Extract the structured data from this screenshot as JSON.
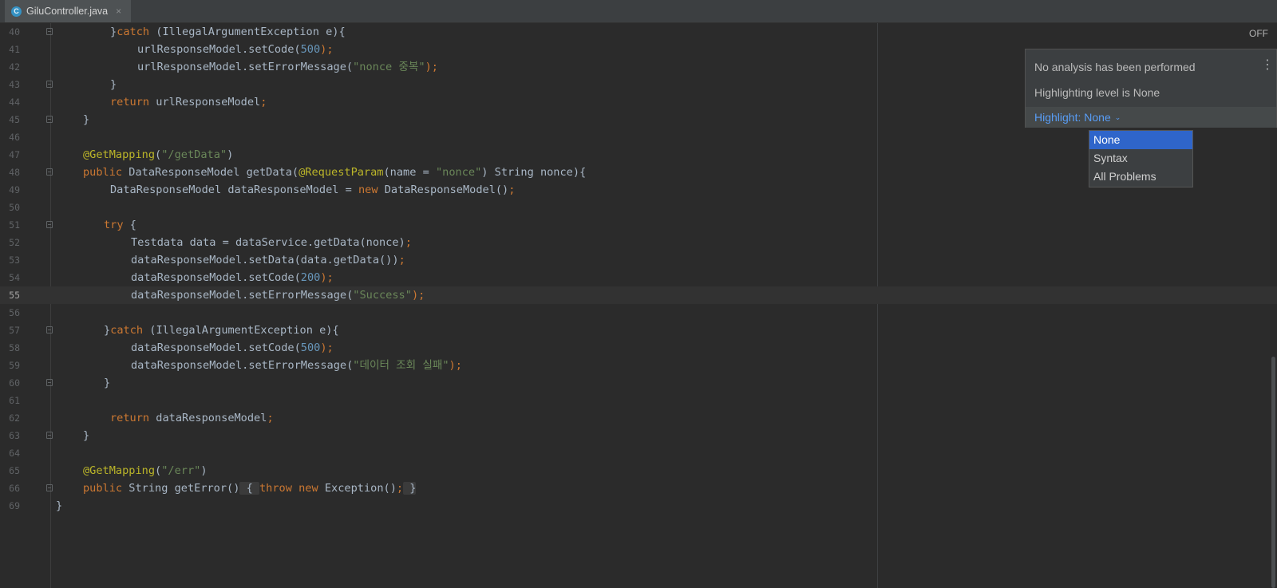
{
  "tab": {
    "icon_letter": "C",
    "filename": "GiluController.java",
    "close": "×"
  },
  "indicator": {
    "status": "OFF"
  },
  "popup": {
    "line1": "No analysis has been performed",
    "line2": "Highlighting level is None",
    "menu_glyph": "⋮",
    "highlight_link": "Highlight: None",
    "chevron": "⌄"
  },
  "dropdown": {
    "options": [
      "None",
      "Syntax",
      "All Problems"
    ],
    "selected": "None"
  },
  "code": {
    "current_line": "55",
    "lines": [
      {
        "num": "40",
        "tokens": [
          "}",
          "catch",
          " (IllegalArgumentException e){"
        ]
      },
      {
        "num": "41",
        "tokens": [
          "urlResponseModel.setCode(",
          "500",
          ");"
        ]
      },
      {
        "num": "42",
        "tokens": [
          "urlResponseModel.setErrorMessage(",
          "\"nonce 중복\"",
          ");"
        ]
      },
      {
        "num": "43",
        "tokens": [
          "}"
        ]
      },
      {
        "num": "44",
        "tokens": [
          "return",
          " urlResponseModel",
          ";"
        ]
      },
      {
        "num": "45",
        "tokens": [
          "}"
        ]
      },
      {
        "num": "46",
        "tokens": []
      },
      {
        "num": "47",
        "tokens": [
          "@GetMapping",
          "(",
          "\"/getData\"",
          ")"
        ]
      },
      {
        "num": "48",
        "tokens": [
          "public",
          " DataResponseModel getData(",
          "@RequestParam",
          "(name = ",
          "\"nonce\"",
          ") String nonce){"
        ]
      },
      {
        "num": "49",
        "tokens": [
          "DataResponseModel dataResponseModel = ",
          "new",
          " DataResponseModel()",
          ";"
        ]
      },
      {
        "num": "50",
        "tokens": []
      },
      {
        "num": "51",
        "tokens": [
          "try",
          " {"
        ]
      },
      {
        "num": "52",
        "tokens": [
          "Testdata data = dataService.getData(nonce)",
          ";"
        ]
      },
      {
        "num": "53",
        "tokens": [
          "dataResponseModel.setData(data.getData())",
          ";"
        ]
      },
      {
        "num": "54",
        "tokens": [
          "dataResponseModel.setCode(",
          "200",
          ");"
        ]
      },
      {
        "num": "55",
        "tokens": [
          "dataResponseModel.setErrorMessage(",
          "\"Success\"",
          ");"
        ]
      },
      {
        "num": "56",
        "tokens": []
      },
      {
        "num": "57",
        "tokens": [
          "}",
          "catch",
          " (IllegalArgumentException e){"
        ]
      },
      {
        "num": "58",
        "tokens": [
          "dataResponseModel.setCode(",
          "500",
          ");"
        ]
      },
      {
        "num": "59",
        "tokens": [
          "dataResponseModel.setErrorMessage(",
          "\"데이터 조회 실패\"",
          ");"
        ]
      },
      {
        "num": "60",
        "tokens": [
          "}"
        ]
      },
      {
        "num": "61",
        "tokens": []
      },
      {
        "num": "62",
        "tokens": [
          "return",
          " dataResponseModel",
          ";"
        ]
      },
      {
        "num": "63",
        "tokens": [
          "}"
        ]
      },
      {
        "num": "64",
        "tokens": []
      },
      {
        "num": "65",
        "tokens": [
          "@GetMapping",
          "(",
          "\"/err\"",
          ")"
        ]
      },
      {
        "num": "66",
        "tokens": [
          "public",
          " String getError()",
          " { ",
          "throw",
          " ",
          "new",
          " Exception()",
          ";",
          " }"
        ]
      },
      {
        "num": "69",
        "tokens": [
          "}"
        ]
      }
    ]
  }
}
